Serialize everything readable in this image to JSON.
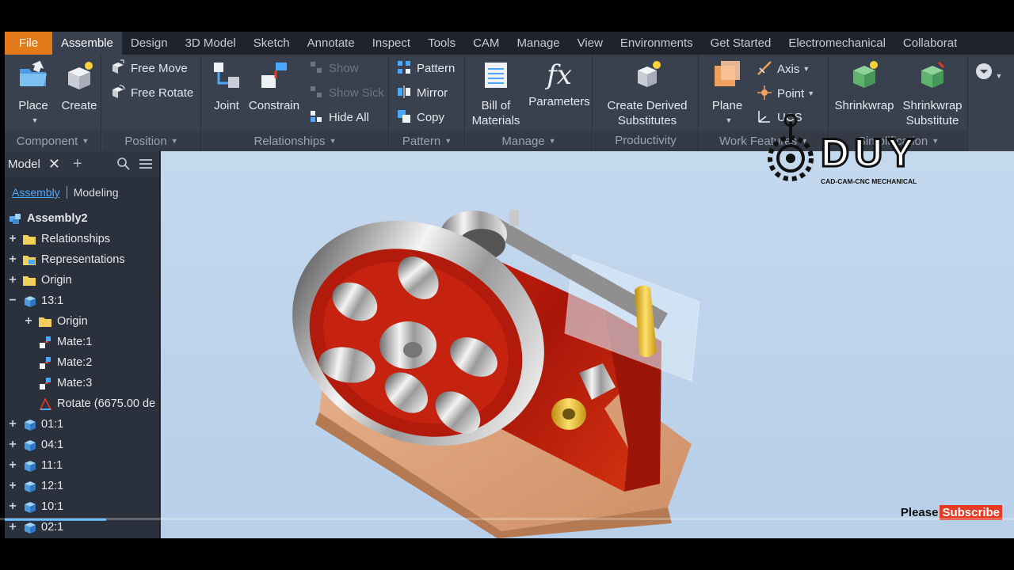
{
  "tabs": [
    "File",
    "Assemble",
    "Design",
    "3D Model",
    "Sketch",
    "Annotate",
    "Inspect",
    "Tools",
    "CAM",
    "Manage",
    "View",
    "Environments",
    "Get Started",
    "Electromechanical",
    "Collaborat"
  ],
  "ribbon": {
    "component": {
      "title": "Component",
      "place": "Place",
      "create": "Create"
    },
    "position": {
      "title": "Position",
      "free_move": "Free Move",
      "free_rotate": "Free Rotate"
    },
    "relationships": {
      "title": "Relationships",
      "joint": "Joint",
      "constrain": "Constrain",
      "show": "Show",
      "show_sick": "Show Sick",
      "hide_all": "Hide All"
    },
    "pattern": {
      "title": "Pattern",
      "pattern": "Pattern",
      "mirror": "Mirror",
      "copy": "Copy"
    },
    "manage": {
      "title": "Manage",
      "bom_line1": "Bill of",
      "bom_line2": "Materials",
      "parameters": "Parameters"
    },
    "productivity": {
      "title": "Productivity",
      "line1": "Create Derived",
      "line2": "Substitutes"
    },
    "work_features": {
      "title": "Work Features",
      "plane": "Plane",
      "axis": "Axis",
      "point": "Point",
      "ucs": "UCS"
    },
    "simplification": {
      "title": "Simplification",
      "shrinkwrap": "Shrinkwrap",
      "sub_line1": "Shrinkwrap",
      "sub_line2": "Substitute"
    }
  },
  "browser": {
    "tab_label": "Model",
    "mode_assembly": "Assembly",
    "mode_modeling": "Modeling",
    "tree": [
      {
        "label": "Assembly2",
        "level": 0,
        "exp": "",
        "icon": "assembly-icon"
      },
      {
        "label": "Relationships",
        "level": 1,
        "exp": "+",
        "icon": "folder-icon"
      },
      {
        "label": "Representations",
        "level": 1,
        "exp": "+",
        "icon": "representations-icon"
      },
      {
        "label": "Origin",
        "level": 1,
        "exp": "+",
        "icon": "folder-icon"
      },
      {
        "label": "13:1",
        "level": 1,
        "exp": "−",
        "icon": "part-icon"
      },
      {
        "label": "Origin",
        "level": 2,
        "exp": "+",
        "icon": "folder-icon"
      },
      {
        "label": "Mate:1",
        "level": 2,
        "exp": "",
        "icon": "mate-icon"
      },
      {
        "label": "Mate:2",
        "level": 2,
        "exp": "",
        "icon": "mate-icon"
      },
      {
        "label": "Mate:3",
        "level": 2,
        "exp": "",
        "icon": "mate-icon"
      },
      {
        "label": "Rotate (6675.00 de",
        "level": 2,
        "exp": "",
        "icon": "rotate-icon"
      },
      {
        "label": "01:1",
        "level": 1,
        "exp": "+",
        "icon": "part-icon"
      },
      {
        "label": "04:1",
        "level": 1,
        "exp": "+",
        "icon": "part-icon"
      },
      {
        "label": "11:1",
        "level": 1,
        "exp": "+",
        "icon": "part-icon"
      },
      {
        "label": "12:1",
        "level": 1,
        "exp": "+",
        "icon": "part-icon"
      },
      {
        "label": "10:1",
        "level": 1,
        "exp": "+",
        "icon": "part-icon"
      },
      {
        "label": "02:1",
        "level": 1,
        "exp": "+",
        "icon": "part-icon"
      }
    ]
  },
  "watermark": {
    "brand": "DUY",
    "tagline": "CAD-CAM-CNC MECHANICAL"
  },
  "subscribe": {
    "please": "Please",
    "subscribe": "Subscribe"
  }
}
